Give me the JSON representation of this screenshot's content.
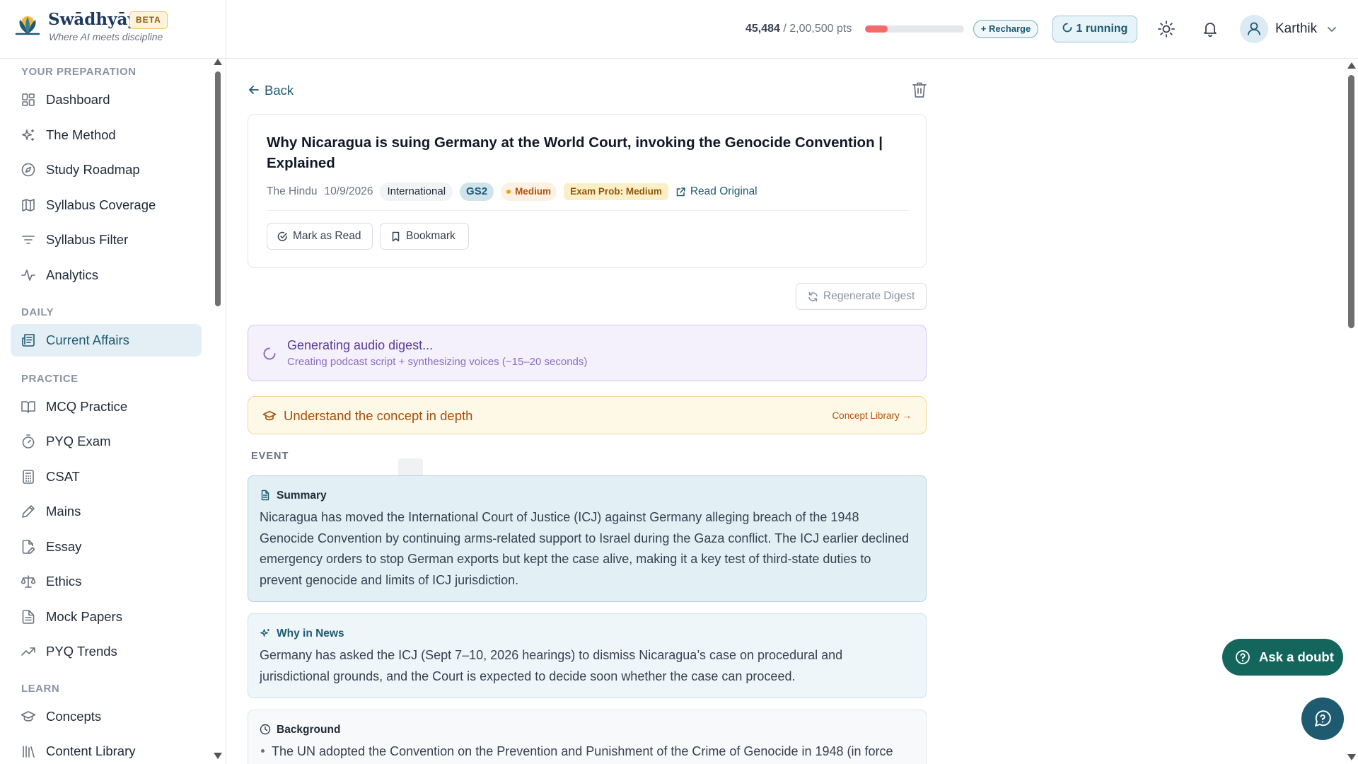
{
  "brand": {
    "name": "Swādhyāya",
    "badge": "BETA",
    "tagline": "Where AI meets discipline"
  },
  "header": {
    "points_value": "45,484",
    "points_total": "/ 2,00,500 pts",
    "points_fraction": 0.227,
    "recharge_label": "+ Recharge",
    "running_label": "1 running",
    "user_name": "Karthik"
  },
  "sidebar": {
    "sections": [
      {
        "title": "YOUR PREPARATION",
        "items": [
          {
            "label": "Dashboard",
            "icon": "grid-icon"
          },
          {
            "label": "The Method",
            "icon": "sparkles-icon"
          },
          {
            "label": "Study Roadmap",
            "icon": "compass-icon"
          },
          {
            "label": "Syllabus Coverage",
            "icon": "map-icon"
          },
          {
            "label": "Syllabus Filter",
            "icon": "filter-icon"
          },
          {
            "label": "Analytics",
            "icon": "activity-icon"
          }
        ]
      },
      {
        "title": "DAILY",
        "items": [
          {
            "label": "Current Affairs",
            "icon": "newspaper-icon",
            "active": true
          }
        ]
      },
      {
        "title": "PRACTICE",
        "items": [
          {
            "label": "MCQ Practice",
            "icon": "book-open-icon"
          },
          {
            "label": "PYQ Exam",
            "icon": "timer-icon"
          },
          {
            "label": "CSAT",
            "icon": "calculator-icon"
          },
          {
            "label": "Mains",
            "icon": "pen-icon"
          },
          {
            "label": "Essay",
            "icon": "file-pen-icon"
          },
          {
            "label": "Ethics",
            "icon": "scale-icon"
          },
          {
            "label": "Mock Papers",
            "icon": "file-text-icon"
          },
          {
            "label": "PYQ Trends",
            "icon": "trending-up-icon"
          }
        ]
      },
      {
        "title": "LEARN",
        "items": [
          {
            "label": "Concepts",
            "icon": "graduation-cap-icon"
          },
          {
            "label": "Content Library",
            "icon": "library-icon"
          }
        ]
      }
    ]
  },
  "article": {
    "back_label": "Back",
    "title": "Why Nicaragua is suing Germany at the World Court, invoking the Genocide Convention | Explained",
    "source": "The Hindu",
    "date": "10/9/2026",
    "category": "International",
    "paper": "GS2",
    "difficulty": "Medium",
    "exam_prob": "Exam Prob: Medium",
    "read_original": "Read Original",
    "mark_read_label": "Mark as Read",
    "bookmark_label": "Bookmark"
  },
  "regenerate_label": "Regenerate Digest",
  "audio_status": {
    "title": "Generating audio digest...",
    "subtitle": "Creating podcast script + synthesizing voices (~15–20 seconds)"
  },
  "concept_banner": {
    "label": "Understand the concept in depth",
    "link": "Concept Library →"
  },
  "event_label": "EVENT",
  "summary": {
    "heading": "Summary",
    "text": "Nicaragua has moved the International Court of Justice (ICJ) against Germany alleging breach of the 1948 Genocide Convention by continuing arms-related support to Israel during the Gaza conflict. The ICJ earlier declined emergency orders to stop German exports but kept the case alive, making it a key test of third-state duties to prevent genocide and limits of ICJ jurisdiction."
  },
  "why_in_news": {
    "heading": "Why in News",
    "text": "Germany has asked the ICJ (Sept 7–10, 2026 hearings) to dismiss Nicaragua’s case on procedural and jurisdictional grounds, and the Court is expected to decide soon whether the case can proceed."
  },
  "background": {
    "heading": "Background",
    "bullet": "The UN adopted the Convention on the Prevention and Punishment of the Crime of Genocide in 1948 (in force"
  },
  "ask_doubt_label": "Ask a doubt",
  "colors": {
    "accent": "#1e5a70",
    "fab": "#14665d",
    "progress": "#f26a6a"
  }
}
